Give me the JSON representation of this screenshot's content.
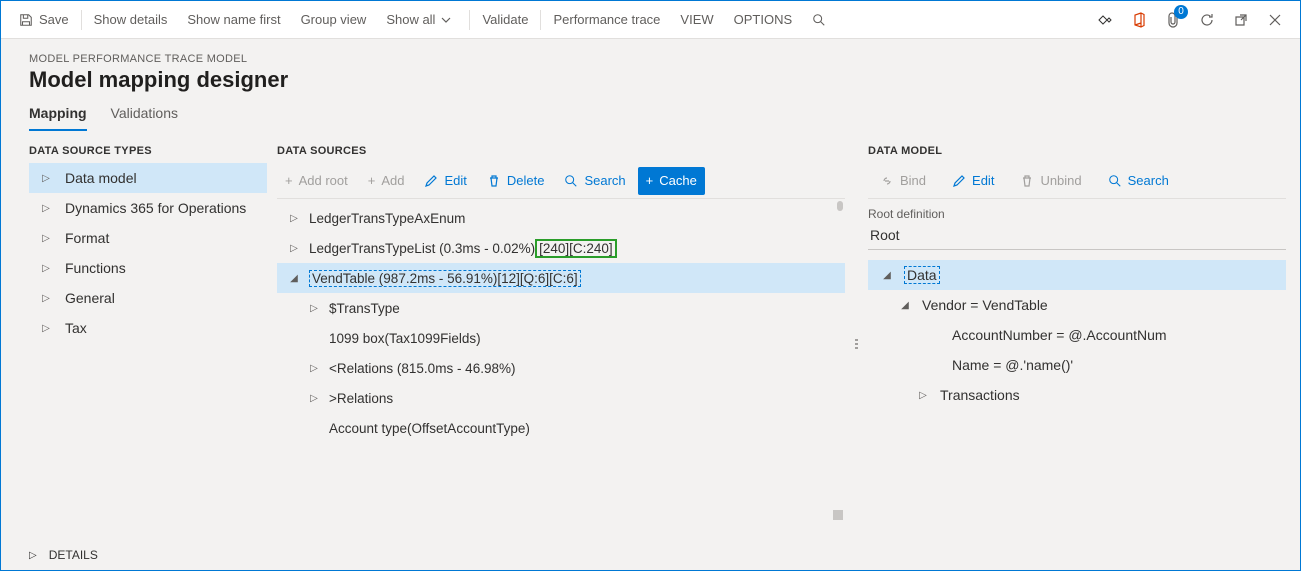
{
  "toolbar": {
    "save": "Save",
    "show_details": "Show details",
    "show_name_first": "Show name first",
    "group_view": "Group view",
    "show_all": "Show all",
    "validate": "Validate",
    "perf_trace": "Performance trace",
    "view": "VIEW",
    "options": "OPTIONS"
  },
  "badge_count": "0",
  "header": {
    "breadcrumb": "MODEL PERFORMANCE TRACE MODEL",
    "title": "Model mapping designer"
  },
  "tabs": {
    "mapping": "Mapping",
    "validations": "Validations"
  },
  "types": {
    "label": "DATA SOURCE TYPES",
    "items": [
      "Data model",
      "Dynamics 365 for Operations",
      "Format",
      "Functions",
      "General",
      "Tax"
    ]
  },
  "sources": {
    "label": "DATA SOURCES",
    "actions": {
      "add_root": "Add root",
      "add": "Add",
      "edit": "Edit",
      "delete": "Delete",
      "search": "Search",
      "cache": "Cache"
    },
    "rows": {
      "r0": "LedgerTransTypeAxEnum",
      "r1_main": "LedgerTransTypeList (0.3ms - 0.02%)",
      "r1_green": "[240][C:240]",
      "r2": "VendTable (987.2ms - 56.91%)[12][Q:6][C:6]",
      "r3": "$TransType",
      "r4": "1099 box(Tax1099Fields)",
      "r5": "<Relations (815.0ms - 46.98%)",
      "r6": ">Relations",
      "r7": "Account type(OffsetAccountType)"
    }
  },
  "model": {
    "label": "DATA MODEL",
    "actions": {
      "bind": "Bind",
      "edit": "Edit",
      "unbind": "Unbind",
      "search": "Search"
    },
    "root_label": "Root definition",
    "root_value": "Root",
    "rows": {
      "data": "Data",
      "vendor": "Vendor = VendTable",
      "account": "AccountNumber = @.AccountNum",
      "name": "Name = @.'name()'",
      "trans": "Transactions"
    }
  },
  "details": "DETAILS"
}
